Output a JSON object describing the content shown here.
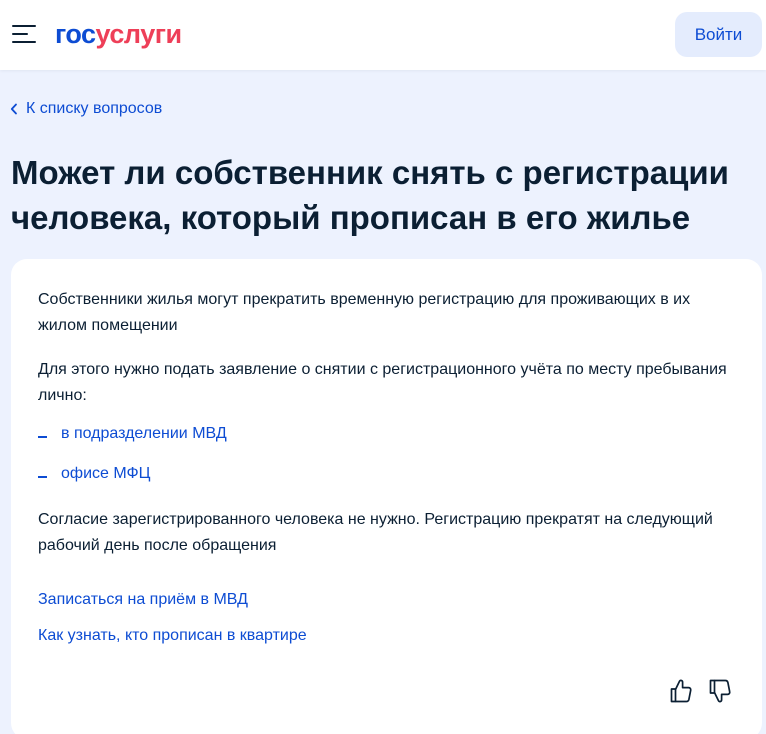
{
  "header": {
    "logo_part1": "гос",
    "logo_part2": "услуги",
    "login_label": "Войти"
  },
  "nav": {
    "back_label": "К списку вопросов"
  },
  "page": {
    "title": "Может ли собственник снять с регистрации человека, который прописан в его жилье"
  },
  "answer": {
    "paragraph1": "Собственники жилья могут прекратить временную регистрацию для проживающих в их жилом помещении",
    "paragraph2": "Для этого нужно подать заявление о снятии с регистрационного учёта по месту пребывания лично:",
    "list": [
      "в подразделении МВД",
      "офисе МФЦ"
    ],
    "paragraph3": "Согласие зарегистрированного человека не нужно. Регистрацию прекратят на следующий рабочий день после обращения",
    "links": [
      "Записаться на приём в МВД",
      "Как узнать, кто прописан в квартире"
    ]
  },
  "feedback": {
    "like_icon": "thumb-up-icon",
    "dislike_icon": "thumb-down-icon"
  },
  "colors": {
    "brand_blue": "#0d4cd3",
    "brand_red": "#ee3f58",
    "page_bg": "#edf2fe",
    "text": "#0b1f33"
  }
}
